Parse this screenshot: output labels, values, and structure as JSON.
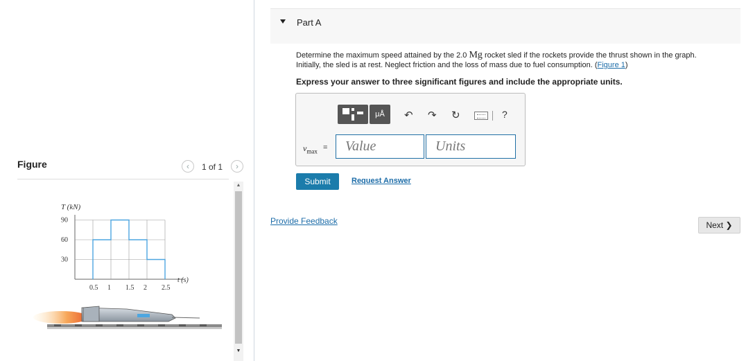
{
  "figure": {
    "title": "Figure",
    "pager": "1 of 1",
    "prev_icon": "‹",
    "next_icon": "›",
    "graph": {
      "ylabel": "T (kN)",
      "xlabel": "t (s)",
      "y_ticks": [
        "90",
        "60",
        "30"
      ],
      "x_ticks": [
        "0.5",
        "1",
        "1.5",
        "2",
        "2.5"
      ],
      "steps": [
        {
          "t_start": 0.5,
          "t_end": 1.0,
          "T": 60
        },
        {
          "t_start": 1.0,
          "t_end": 1.5,
          "T": 90
        },
        {
          "t_start": 1.5,
          "t_end": 2.0,
          "T": 60
        },
        {
          "t_start": 2.0,
          "t_end": 2.5,
          "T": 30
        }
      ],
      "line_color": "#4da6e0"
    }
  },
  "question": {
    "part_title": "Part A",
    "problem_pre": "Determine the maximum speed attained by the 2.0 ",
    "problem_unit": "Mg",
    "problem_mid": " rocket sled if the rockets provide the thrust shown in the graph.",
    "problem_line2": "Initially, the sled is at rest. Neglect friction and the loss of mass due to fuel consumption. (",
    "figure_link": "Figure 1",
    "problem_end": ")",
    "instruction": "Express your answer to three significant figures and include the appropriate units.",
    "toolbar": {
      "units_tool": "μÅ",
      "undo_icon": "↶",
      "redo_icon": "↷",
      "reset_icon": "↻",
      "help_icon": "?"
    },
    "var_label": "v",
    "var_sub": "max",
    "eq": "=",
    "value_placeholder": "Value",
    "units_placeholder": "Units",
    "submit_label": "Submit",
    "request_answer_label": "Request Answer"
  },
  "footer": {
    "feedback_label": "Provide Feedback",
    "next_label": "Next ❯"
  }
}
